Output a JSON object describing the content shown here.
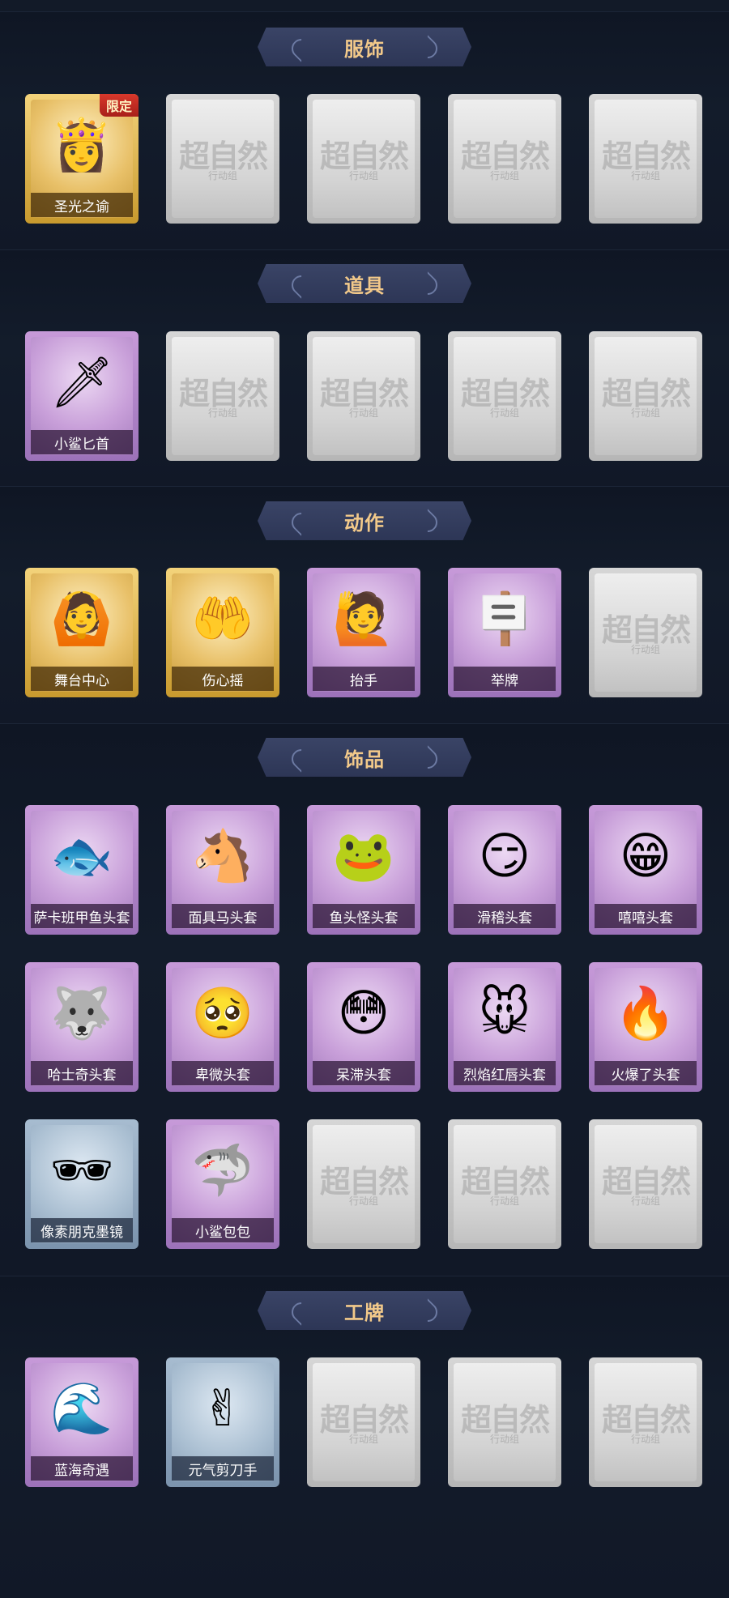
{
  "empty_watermark": {
    "text": "超自然",
    "sub": "行动组"
  },
  "sections": [
    {
      "title": "服饰",
      "items": [
        {
          "name": "圣光之谕",
          "rarity": "gold",
          "icon": "portrait-girl-icon",
          "glyph": "👸",
          "tag": "限定"
        },
        {
          "empty": true
        },
        {
          "empty": true
        },
        {
          "empty": true
        },
        {
          "empty": true
        }
      ]
    },
    {
      "title": "道具",
      "items": [
        {
          "name": "小鲨匕首",
          "rarity": "purple",
          "icon": "shark-dagger-icon",
          "glyph": "🗡"
        },
        {
          "empty": true
        },
        {
          "empty": true
        },
        {
          "empty": true
        },
        {
          "empty": true
        }
      ]
    },
    {
      "title": "动作",
      "items": [
        {
          "name": "舞台中心",
          "rarity": "gold",
          "icon": "pose-center-icon",
          "glyph": "🙆"
        },
        {
          "name": "伤心摇",
          "rarity": "gold",
          "icon": "heart-pose-icon",
          "glyph": "🤲"
        },
        {
          "name": "抬手",
          "rarity": "purple",
          "icon": "raise-hand-icon",
          "glyph": "🙋"
        },
        {
          "name": "举牌",
          "rarity": "purple",
          "icon": "hold-sign-icon",
          "glyph": "🪧"
        },
        {
          "empty": true
        }
      ]
    },
    {
      "title": "饰品",
      "items": [
        {
          "name": "萨卡班甲鱼头套",
          "rarity": "purple",
          "icon": "fish-head-icon",
          "glyph": "🐟"
        },
        {
          "name": "面具马头套",
          "rarity": "purple",
          "icon": "horse-head-icon",
          "glyph": "🐴"
        },
        {
          "name": "鱼头怪头套",
          "rarity": "purple",
          "icon": "fish-monster-icon",
          "glyph": "🐸"
        },
        {
          "name": "滑稽头套",
          "rarity": "purple",
          "icon": "funny-face-icon",
          "glyph": "😏"
        },
        {
          "name": "嘻嘻头套",
          "rarity": "purple",
          "icon": "grin-face-icon",
          "glyph": "😁"
        },
        {
          "name": "哈士奇头套",
          "rarity": "purple",
          "icon": "husky-head-icon",
          "glyph": "🐺"
        },
        {
          "name": "卑微头套",
          "rarity": "purple",
          "icon": "humble-face-icon",
          "glyph": "🥺"
        },
        {
          "name": "呆滞头套",
          "rarity": "purple",
          "icon": "dazed-face-icon",
          "glyph": "😳"
        },
        {
          "name": "烈焰红唇头套",
          "rarity": "purple",
          "icon": "pikachu-head-icon",
          "glyph": "🐭"
        },
        {
          "name": "火爆了头套",
          "rarity": "purple",
          "icon": "fire-face-icon",
          "glyph": "🔥"
        },
        {
          "name": "像素朋克墨镜",
          "rarity": "blue",
          "icon": "pixel-sunglasses-icon",
          "glyph": "🕶"
        },
        {
          "name": "小鲨包包",
          "rarity": "purple",
          "icon": "shark-bag-icon",
          "glyph": "🦈"
        },
        {
          "empty": true
        },
        {
          "empty": true
        },
        {
          "empty": true
        }
      ]
    },
    {
      "title": "工牌",
      "items": [
        {
          "name": "蓝海奇遇",
          "rarity": "purple",
          "icon": "ocean-card-icon",
          "glyph": "🌊"
        },
        {
          "name": "元气剪刀手",
          "rarity": "blue",
          "icon": "peace-sign-card-icon",
          "glyph": "✌"
        },
        {
          "empty": true
        },
        {
          "empty": true
        },
        {
          "empty": true
        }
      ]
    }
  ]
}
